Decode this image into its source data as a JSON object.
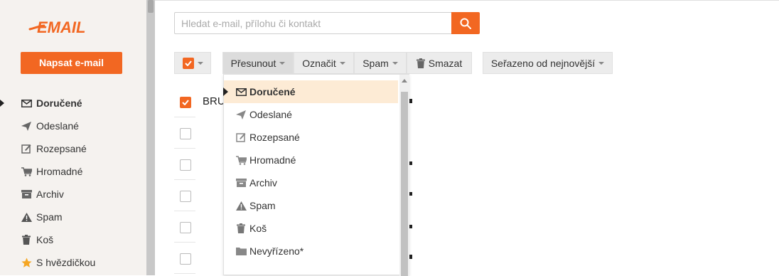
{
  "app": {
    "logo_text": "EMAIL"
  },
  "sidebar": {
    "compose_label": "Napsat e-mail",
    "items": [
      {
        "label": "Doručené",
        "icon": "envelope-icon",
        "active": true
      },
      {
        "label": "Odeslané",
        "icon": "send-icon"
      },
      {
        "label": "Rozepsané",
        "icon": "edit-icon"
      },
      {
        "label": "Hromadné",
        "icon": "cart-icon"
      },
      {
        "label": "Archiv",
        "icon": "archive-icon"
      },
      {
        "label": "Spam",
        "icon": "warning-icon"
      },
      {
        "label": "Koš",
        "icon": "trash-icon"
      },
      {
        "label": "S hvězdičkou",
        "icon": "star-icon"
      }
    ]
  },
  "search": {
    "placeholder": "Hledat e-mail, přílohu či kontakt"
  },
  "toolbar": {
    "move_label": "Přesunout",
    "mark_label": "Označit",
    "spam_label": "Spam",
    "delete_label": "Smazat",
    "sort_label": "Seřazeno od nejnovější"
  },
  "list": {
    "header_text": "BRU"
  },
  "move_menu": {
    "items": [
      {
        "label": "Doručené",
        "icon": "envelope-icon",
        "selected": true
      },
      {
        "label": "Odeslané",
        "icon": "send-icon"
      },
      {
        "label": "Rozepsané",
        "icon": "edit-icon"
      },
      {
        "label": "Hromadné",
        "icon": "cart-icon"
      },
      {
        "label": "Archiv",
        "icon": "archive-icon"
      },
      {
        "label": "Spam",
        "icon": "warning-icon"
      },
      {
        "label": "Koš",
        "icon": "trash-icon"
      },
      {
        "label": "Nevyřízeno*",
        "icon": "folder-icon"
      }
    ]
  },
  "colors": {
    "accent": "#f26722",
    "sidebar_bg": "#f5f2ef",
    "selected_bg": "#fdebd5"
  }
}
